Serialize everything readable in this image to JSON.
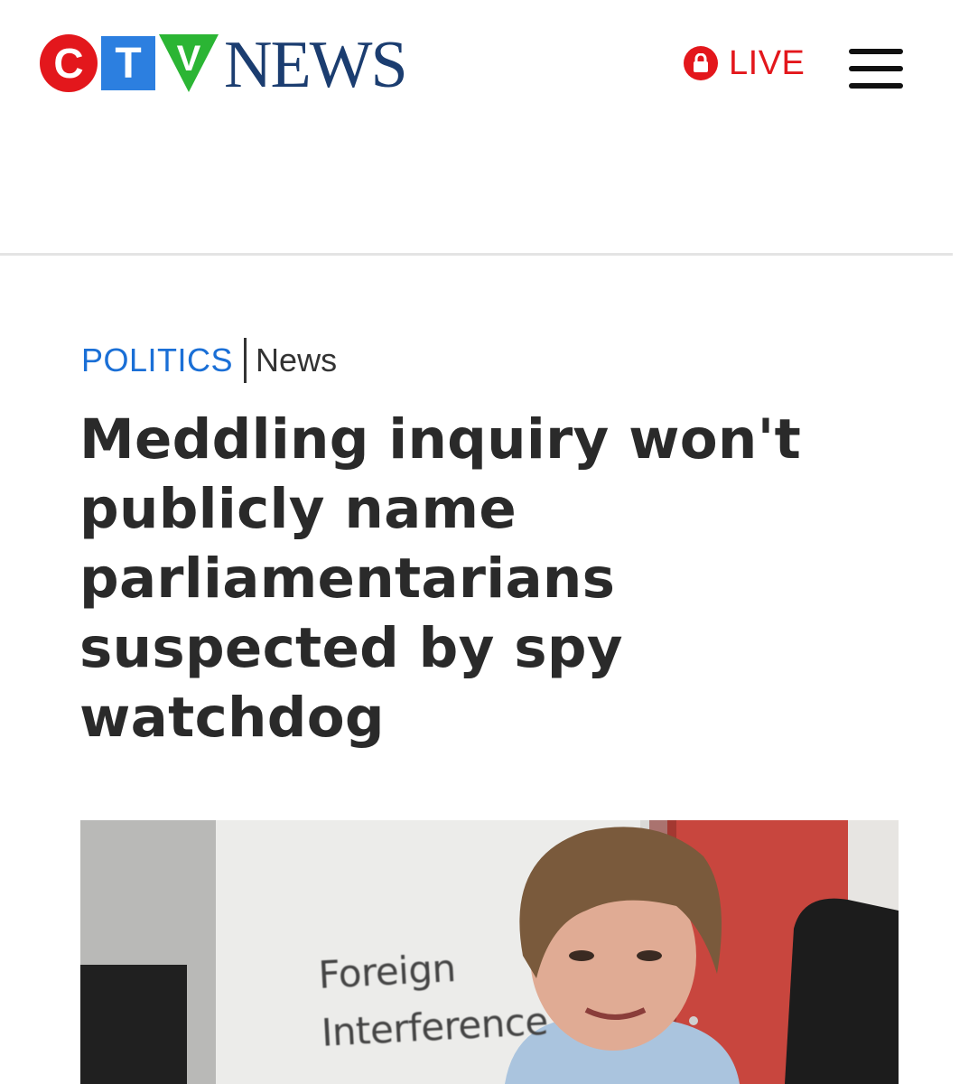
{
  "header": {
    "logo": {
      "letters": [
        "C",
        "T",
        "V"
      ],
      "wordmark": "NEWS"
    },
    "live_label": "LIVE",
    "colors": {
      "live": "#e3171c",
      "logo_red": "#e3171c",
      "logo_blue": "#2c7fe0",
      "logo_green": "#2bb534",
      "logo_navy": "#1b3d70"
    }
  },
  "article": {
    "category": "POLITICS",
    "subcategory": "News",
    "headline": "Meddling inquiry won't publicly name parliamentarians suspected by spy watchdog",
    "hero_image": {
      "sign_text": [
        "Foreign",
        "Interference"
      ]
    }
  }
}
